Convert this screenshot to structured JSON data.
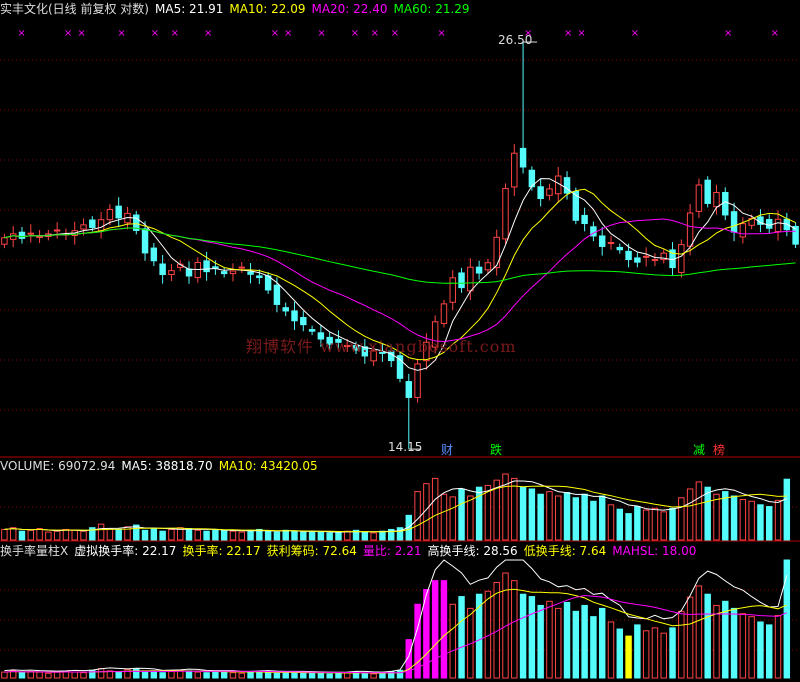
{
  "price_header": {
    "title": "实丰文化(日线 前复权 对数)",
    "ma5": "MA5: 21.91",
    "ma10": "MA10: 22.09",
    "ma20": "MA20: 22.40",
    "ma60": "MA60: 21.29"
  },
  "volume_header": {
    "title": "VOLUME: 69072.94",
    "ma5": "MA5: 38818.70",
    "ma10": "MA10: 43420.05"
  },
  "turnover_header": {
    "title": "换手率量柱X",
    "virtual": "虚拟换手率: 22.17",
    "turnover": "换手率: 22.17",
    "profit_chips": "获利筹码: 72.64",
    "vol_ratio": "量比: 2.21",
    "high_line": "高换手线: 28.56",
    "low_line": "低换手线: 7.64",
    "mahsl": "MAHSL: 18.00"
  },
  "annotations": {
    "high": "26.50",
    "low": "14.15",
    "badges": [
      "财",
      "跌",
      "减",
      "榜"
    ]
  },
  "watermark": "翔博软件 www.xiangbosoft.com",
  "colors": {
    "up": "#ff4444",
    "down": "#54fcfc",
    "ma5": "#ffffff",
    "ma10": "#ffff00",
    "ma20": "#ff00ff",
    "ma60": "#00ff00",
    "grid": "#8b0000",
    "badge_blue": "#5a8cff",
    "badge_green": "#00ff00",
    "badge_red": "#ff3030",
    "turn_yellow": "#ffff00",
    "turn_magenta": "#ff00ff"
  },
  "chart_data": [
    {
      "type": "candlestick",
      "panel": "price",
      "scale": "log",
      "ylim": [
        14.0,
        27.5
      ],
      "grid": "horizontal-dotted",
      "high_price": 26.5,
      "low_price": 14.15,
      "start_close": 19.6,
      "daily_change_pct": [
        0.6,
        -0.7,
        0.8,
        -0.5,
        0.4,
        0.6,
        -0.6,
        0.5,
        0.9,
        -0.4,
        1.2,
        1.6,
        -1.3,
        0.7,
        -2.6,
        -3.4,
        -1.2,
        -2.1,
        0.6,
        1.0,
        -1.8,
        2.1,
        -1.4,
        0.5,
        -0.8,
        0.4,
        0.6,
        -1.1,
        -0.5,
        -1.9,
        -2.2,
        -1.0,
        -1.5,
        -0.6,
        -1.0,
        -1.2,
        -0.8,
        0.3,
        -0.5,
        -0.7,
        -0.9,
        0.8,
        -0.3,
        -1.2,
        -2.7,
        -2.9,
        5.3,
        3.4,
        3.2,
        2.8,
        4.1,
        -1.5,
        3.2,
        -0.9,
        1.6,
        4.0,
        7.8,
        5.6,
        -2.1,
        -3.0,
        -1.8,
        1.5,
        2.0,
        -2.6,
        -4.1,
        -0.5,
        -1.9,
        -1.6,
        0.6,
        -1.1,
        -1.5,
        -0.4,
        0.9,
        -0.5,
        1.0,
        -2.2,
        3.6,
        5.0,
        4.4,
        -2.8,
        1.7,
        -3.4,
        -2.6,
        1.3,
        0.8,
        -0.9,
        -0.6,
        1.4,
        -1.6,
        -2.2
      ],
      "series": [
        {
          "name": "MA5",
          "last": 21.91
        },
        {
          "name": "MA10",
          "last": 22.09
        },
        {
          "name": "MA20",
          "last": 22.4
        },
        {
          "name": "MA60",
          "last": 21.29
        }
      ]
    },
    {
      "type": "bar",
      "panel": "volume",
      "values": [
        12,
        14,
        10,
        11,
        13,
        9,
        10,
        12,
        11,
        10,
        14,
        18,
        13,
        12,
        15,
        17,
        11,
        13,
        10,
        12,
        14,
        13,
        11,
        10,
        12,
        11,
        10,
        9,
        11,
        12,
        10,
        9,
        11,
        10,
        9,
        10,
        9,
        8,
        9,
        10,
        11,
        9,
        8,
        10,
        12,
        14,
        28,
        55,
        64,
        70,
        52,
        49,
        58,
        50,
        60,
        62,
        68,
        75,
        70,
        60,
        58,
        52,
        55,
        50,
        54,
        48,
        52,
        44,
        50,
        40,
        35,
        30,
        38,
        34,
        36,
        32,
        36,
        48,
        58,
        66,
        60,
        52,
        55,
        50,
        46,
        44,
        40,
        38,
        45,
        69.07
      ],
      "series": [
        {
          "name": "VOLUME",
          "last": 69072.94
        },
        {
          "name": "MA5",
          "last": 38818.7
        },
        {
          "name": "MA10",
          "last": 43420.05
        }
      ]
    },
    {
      "type": "bar",
      "panel": "turnover",
      "values": [
        1.0,
        1.2,
        0.9,
        1.1,
        1.0,
        0.8,
        1.0,
        1.1,
        1.0,
        0.9,
        1.3,
        1.6,
        1.2,
        1.1,
        1.4,
        1.5,
        1.0,
        1.2,
        0.9,
        1.1,
        1.3,
        1.2,
        1.0,
        0.9,
        1.1,
        1.0,
        0.9,
        0.8,
        1.0,
        1.1,
        0.9,
        0.8,
        1.0,
        0.9,
        0.8,
        0.9,
        0.8,
        0.7,
        0.8,
        0.9,
        1.0,
        0.8,
        0.7,
        0.9,
        1.1,
        1.3,
        6.5,
        12.5,
        15.0,
        16.5,
        16.5,
        12.5,
        13.8,
        11.8,
        14.2,
        14.7,
        16.2,
        17.8,
        16.5,
        14.2,
        13.8,
        12.3,
        13.0,
        11.8,
        12.8,
        11.3,
        12.3,
        10.4,
        11.8,
        9.5,
        8.3,
        7.1,
        9.0,
        8.0,
        8.5,
        7.6,
        8.5,
        11.3,
        13.7,
        15.6,
        14.2,
        12.3,
        13.0,
        11.8,
        10.9,
        10.4,
        9.5,
        9.0,
        10.6,
        22.17
      ],
      "series": [
        {
          "name": "虚拟换手率",
          "last": 22.17
        },
        {
          "name": "换手率",
          "last": 22.17
        },
        {
          "name": "获利筹码",
          "last": 72.64
        },
        {
          "name": "量比",
          "last": 2.21
        },
        {
          "name": "高换手线",
          "last": 28.56
        },
        {
          "name": "低换手线",
          "last": 7.64
        },
        {
          "name": "MAHSL",
          "last": 18.0
        }
      ]
    }
  ]
}
